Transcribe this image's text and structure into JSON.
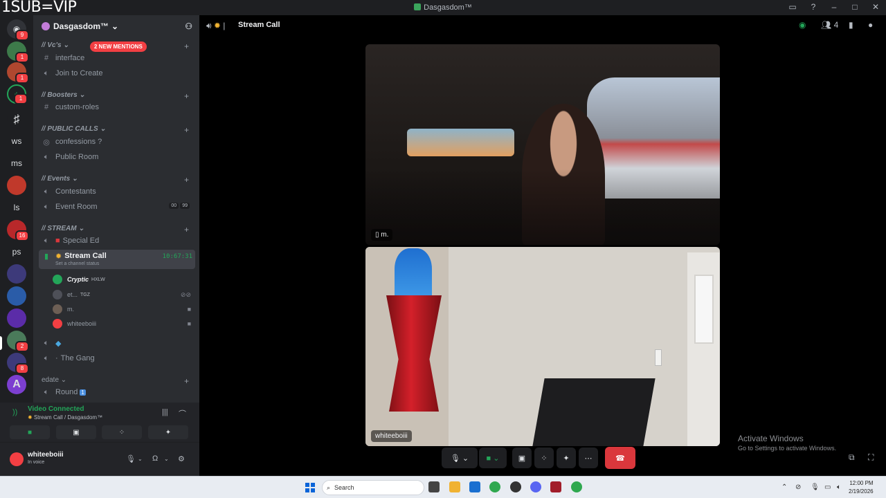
{
  "watermark": "1SUB=VIP",
  "window": {
    "title": "Dasgasdom™"
  },
  "server": {
    "name": "Dasgasdom™"
  },
  "mentions_banner": "2 NEW MENTIONS",
  "guild_badges": [
    "9",
    "1",
    "1",
    "1",
    "16",
    "2",
    "8"
  ],
  "guild_text": [
    "ws",
    "ms",
    "ls",
    "ps"
  ],
  "categories": [
    {
      "label": "// Vc's"
    },
    {
      "label": "// Boosters"
    },
    {
      "label": "// PUBLIC CALLS"
    },
    {
      "label": "// Events"
    },
    {
      "label": "// STREAM"
    },
    {
      "label": "edate"
    }
  ],
  "channels": {
    "interface": "interface",
    "join_to_create": "Join to Create",
    "custom_roles": "custom-roles",
    "confessions": "confessions ?",
    "public_room": "Public Room",
    "contestants": "Contestants",
    "event_room": "Event Room",
    "event_room_counts": [
      "00",
      "99"
    ],
    "special_ed": "Special Ed",
    "stream_call": "Stream Call",
    "stream_timer": "10:67:31",
    "stream_status": "Set a channel status",
    "the_gang": "The Gang",
    "round": "Round"
  },
  "voice_users": [
    {
      "name": "Cryptic",
      "tag": "HXLW"
    },
    {
      "name": "et...",
      "tag": "TGZ"
    },
    {
      "name": "m.",
      "tag": ""
    },
    {
      "name": "whiteeboiii",
      "tag": ""
    }
  ],
  "voice_panel": {
    "status": "Video Connected",
    "location": "Stream Call / Dasgasdom™"
  },
  "user": {
    "name": "whiteeboiii",
    "status": "In voice"
  },
  "stage": {
    "title": "Stream Call",
    "participant_count": "4",
    "tiles": [
      {
        "label": "m."
      },
      {
        "label": "whiteeboiii"
      }
    ]
  },
  "activate": {
    "line1": "Activate Windows",
    "line2": "Go to Settings to activate Windows."
  },
  "taskbar": {
    "search_placeholder": "Search",
    "time": "12:00 PM",
    "date": "2/19/2026"
  },
  "colors": {
    "accent": "#5865f2",
    "connected": "#23a559",
    "danger": "#da373c",
    "mention": "#f23f43"
  }
}
